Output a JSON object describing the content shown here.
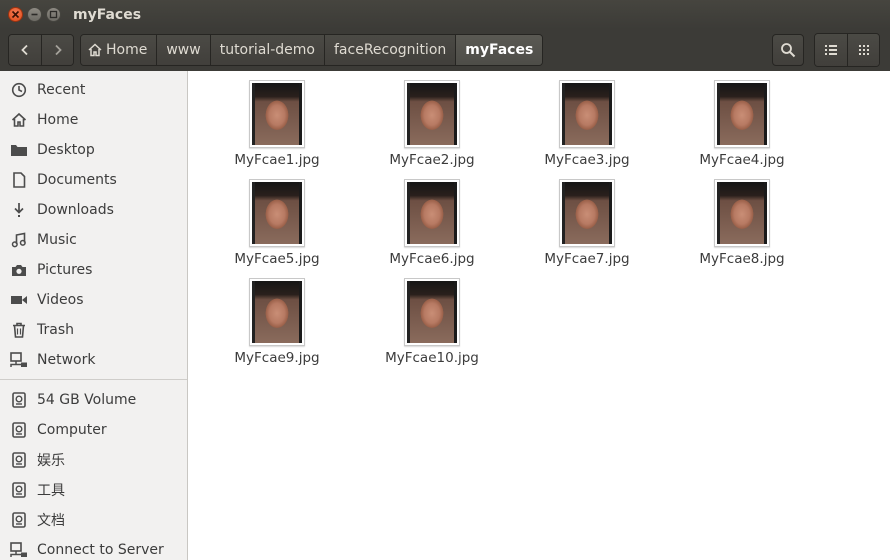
{
  "window": {
    "title": "myFaces"
  },
  "toolbar": {
    "breadcrumbs": [
      "Home",
      "www",
      "tutorial-demo",
      "faceRecognition",
      "myFaces"
    ]
  },
  "sidebar": {
    "places": [
      {
        "label": "Recent",
        "icon": "clock-icon"
      },
      {
        "label": "Home",
        "icon": "home-icon"
      },
      {
        "label": "Desktop",
        "icon": "folder-icon"
      },
      {
        "label": "Documents",
        "icon": "document-icon"
      },
      {
        "label": "Downloads",
        "icon": "download-icon"
      },
      {
        "label": "Music",
        "icon": "music-icon"
      },
      {
        "label": "Pictures",
        "icon": "camera-icon"
      },
      {
        "label": "Videos",
        "icon": "video-icon"
      },
      {
        "label": "Trash",
        "icon": "trash-icon"
      },
      {
        "label": "Network",
        "icon": "network-icon"
      }
    ],
    "devices": [
      {
        "label": "54 GB Volume",
        "icon": "drive-icon"
      },
      {
        "label": "Computer",
        "icon": "drive-icon"
      },
      {
        "label": "娱乐",
        "icon": "drive-icon"
      },
      {
        "label": "工具",
        "icon": "drive-icon"
      },
      {
        "label": "文档",
        "icon": "drive-icon"
      },
      {
        "label": "Connect to Server",
        "icon": "network-icon"
      }
    ]
  },
  "files": [
    "MyFcae1.jpg",
    "MyFcae2.jpg",
    "MyFcae3.jpg",
    "MyFcae4.jpg",
    "MyFcae5.jpg",
    "MyFcae6.jpg",
    "MyFcae7.jpg",
    "MyFcae8.jpg",
    "MyFcae9.jpg",
    "MyFcae10.jpg"
  ]
}
